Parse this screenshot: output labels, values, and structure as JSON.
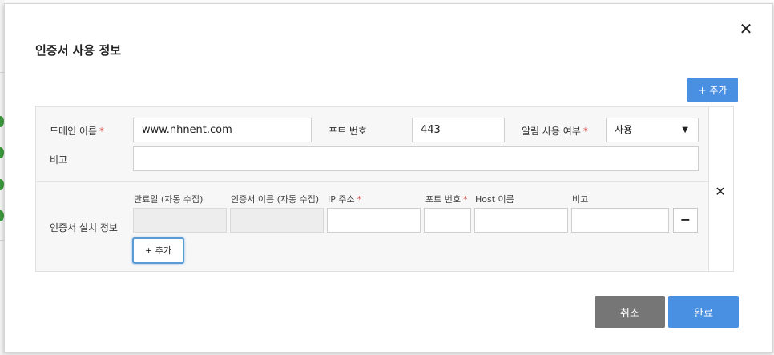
{
  "modal": {
    "title": "인증서 사용 정보",
    "close_icon": "✕",
    "add_top_label": "+ 추가",
    "cancel_label": "취소",
    "confirm_label": "완료"
  },
  "domain_row": {
    "domain_label": "도메인 이름",
    "domain_value": "www.nhnent.com",
    "port_label": "포트 번호",
    "port_value": "443",
    "alert_label": "알림 사용 여부",
    "alert_value": "사용",
    "required_mark": "*",
    "remark_label": "비고",
    "remark_value": ""
  },
  "install": {
    "section_label": "인증서 설치 정보",
    "columns": [
      "만료일 (자동 수집)",
      "인증서 이름 (자동 수집)",
      "IP 주소",
      "포트 번호",
      "Host 이름",
      "비고"
    ],
    "row": {
      "expiry": "",
      "cert_name": "",
      "ip": "",
      "port": "",
      "host": "",
      "remark": ""
    },
    "minus_label": "−",
    "add_label": "+ 추가",
    "remove_icon": "✕"
  },
  "colors": {
    "accent": "#4a90e2",
    "cancel": "#767676",
    "required": "#d9534f"
  }
}
